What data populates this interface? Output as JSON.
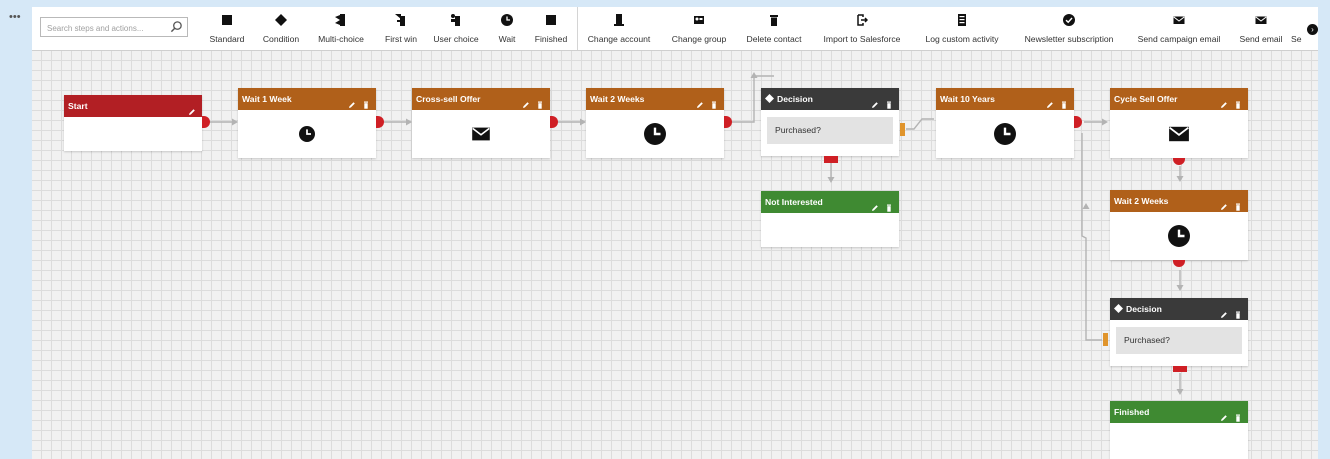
{
  "toolbar": {
    "search_placeholder": "Search steps and actions...",
    "tools": [
      {
        "label": "Standard",
        "icon": "square-icon"
      },
      {
        "label": "Condition",
        "icon": "diamond-icon"
      },
      {
        "label": "Multi-choice",
        "icon": "multi-choice-icon"
      },
      {
        "label": "First win",
        "icon": "first-win-icon"
      },
      {
        "label": "User choice",
        "icon": "user-choice-icon"
      },
      {
        "label": "Wait",
        "icon": "clock-icon"
      },
      {
        "label": "Finished",
        "icon": "stop-icon"
      },
      {
        "label": "Change account",
        "icon": "building-icon"
      },
      {
        "label": "Change group",
        "icon": "group-icon"
      },
      {
        "label": "Delete contact",
        "icon": "trash-icon"
      },
      {
        "label": "Import to Salesforce",
        "icon": "import-icon"
      },
      {
        "label": "Log custom activity",
        "icon": "log-icon"
      },
      {
        "label": "Newsletter subscription",
        "icon": "check-circle-icon"
      },
      {
        "label": "Send campaign email",
        "icon": "envelope-icon"
      },
      {
        "label": "Send email",
        "icon": "envelope-icon"
      },
      {
        "label": "Se",
        "icon": "more-icon"
      }
    ]
  },
  "colors": {
    "start": "#b21f24",
    "wait": "#b0601a",
    "decision": "#3a3a3a",
    "finish": "#3f8a32",
    "port_out": "#cf1f25",
    "port_in": "#e0942b"
  },
  "nodes": {
    "start": {
      "title": "Start"
    },
    "wait1": {
      "title": "Wait 1 Week"
    },
    "crosssell": {
      "title": "Cross-sell Offer"
    },
    "wait2": {
      "title": "Wait 2 Weeks"
    },
    "decision1": {
      "title": "Decision",
      "condition": "Purchased?"
    },
    "notinterested": {
      "title": "Not Interested"
    },
    "wait10": {
      "title": "Wait 10 Years"
    },
    "cyclesell": {
      "title": "Cycle Sell Offer"
    },
    "wait2b": {
      "title": "Wait 2 Weeks"
    },
    "decision2": {
      "title": "Decision",
      "condition": "Purchased?"
    },
    "finished": {
      "title": "Finished"
    }
  }
}
